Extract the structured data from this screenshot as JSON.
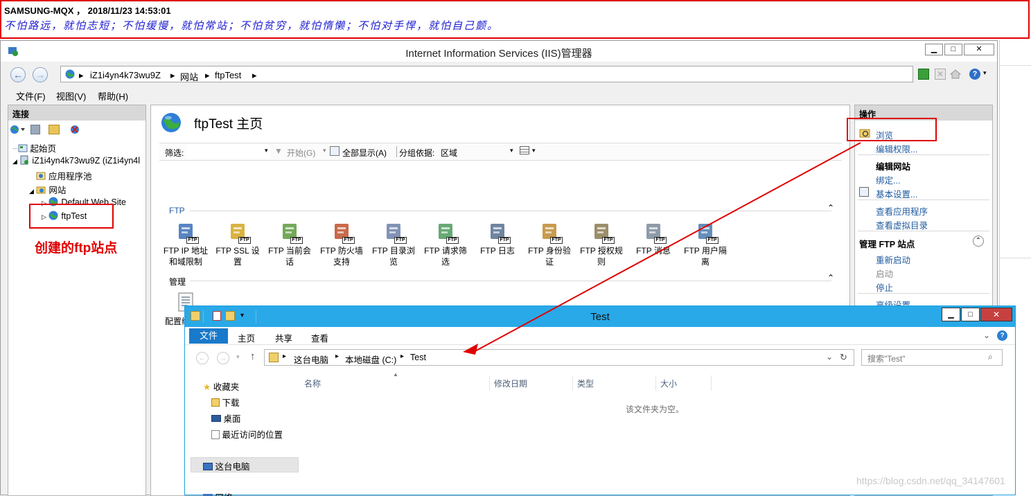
{
  "banner": {
    "line1": "SAMSUNG-MQX ， 2018/11/23 14:53:01",
    "line2": "不怕路远，就怕志短；不怕缓慢，就怕常站；不怕贫穷，就怕惰懒；不怕对手悍，就怕自己颤。"
  },
  "iis": {
    "title": "Internet Information Services (IIS)管理器",
    "window_buttons": [
      "▁",
      "□",
      "✕"
    ],
    "breadcrumb": [
      "iZ1i4yn4k73wu9Z",
      "网站",
      "ftpTest"
    ],
    "menu": [
      "文件(F)",
      "视图(V)",
      "帮助(H)"
    ],
    "connections": {
      "header": "连接",
      "tree": {
        "start_page": "起始页",
        "server": "iZ1i4yn4k73wu9Z (iZ1i4yn4l",
        "app_pools": "应用程序池",
        "sites": "网站",
        "default_site": "Default Web Site",
        "ftp_site": "ftpTest"
      }
    },
    "main": {
      "title": "ftpTest 主页",
      "filter_label": "筛选:",
      "start_label": "开始(G)",
      "show_all_label": "全部显示(A)",
      "group_label": "分组依据:",
      "group_value": "区域",
      "groups": [
        {
          "name": "FTP",
          "items": [
            {
              "line1": "FTP IP 地址",
              "line2": "和域限制",
              "icon": "ip-restrict-icon"
            },
            {
              "line1": "FTP SSL 设",
              "line2": "置",
              "icon": "ssl-lock-icon"
            },
            {
              "line1": "FTP 当前会",
              "line2": "话",
              "icon": "sessions-icon"
            },
            {
              "line1": "FTP 防火墙",
              "line2": "支持",
              "icon": "firewall-icon"
            },
            {
              "line1": "FTP 目录浏",
              "line2": "览",
              "icon": "directory-browse-icon"
            },
            {
              "line1": "FTP 请求筛",
              "line2": "选",
              "icon": "request-filter-icon"
            },
            {
              "line1": "FTP 日志",
              "line2": "",
              "icon": "log-icon"
            },
            {
              "line1": "FTP 身份验",
              "line2": "证",
              "icon": "auth-icon"
            },
            {
              "line1": "FTP 授权规",
              "line2": "则",
              "icon": "authz-rules-icon"
            },
            {
              "line1": "FTP 消息",
              "line2": "",
              "icon": "messages-icon"
            },
            {
              "line1": "FTP 用户隔",
              "line2": "离",
              "icon": "user-isolation-icon"
            }
          ]
        },
        {
          "name": "管理",
          "items": [
            {
              "line1": "配置编辑器",
              "line2": "",
              "icon": "config-editor-icon"
            }
          ]
        }
      ]
    },
    "actions": {
      "header": "操作",
      "browse": "浏览",
      "edit_permissions": "编辑权限...",
      "edit_site_heading": "编辑网站",
      "bindings": "绑定...",
      "basic_settings": "基本设置...",
      "view_applications": "查看应用程序",
      "view_virtual_dirs": "查看虚拟目录",
      "manage_ftp_heading": "管理 FTP 站点",
      "restart": "重新启动",
      "start": "启动",
      "stop": "停止",
      "advanced_settings": "高级设置..."
    }
  },
  "explorer": {
    "title": "Test",
    "ribbon_tabs": [
      "文件",
      "主页",
      "共享",
      "查看"
    ],
    "path": [
      "这台电脑",
      "本地磁盘 (C:)",
      "Test"
    ],
    "search_placeholder": "搜索\"Test\"",
    "nav": {
      "favorites": "收藏夹",
      "downloads": "下载",
      "desktop": "桌面",
      "recent": "最近访问的位置",
      "this_pc": "这台电脑",
      "network": "网络"
    },
    "columns": [
      "名称",
      "修改日期",
      "类型",
      "大小"
    ],
    "empty_text": "该文件夹为空。"
  },
  "annotation": {
    "text": "创建的ftp站点",
    "color": "#e00000"
  },
  "watermark": "https://blog.csdn.net/qq_34147601"
}
